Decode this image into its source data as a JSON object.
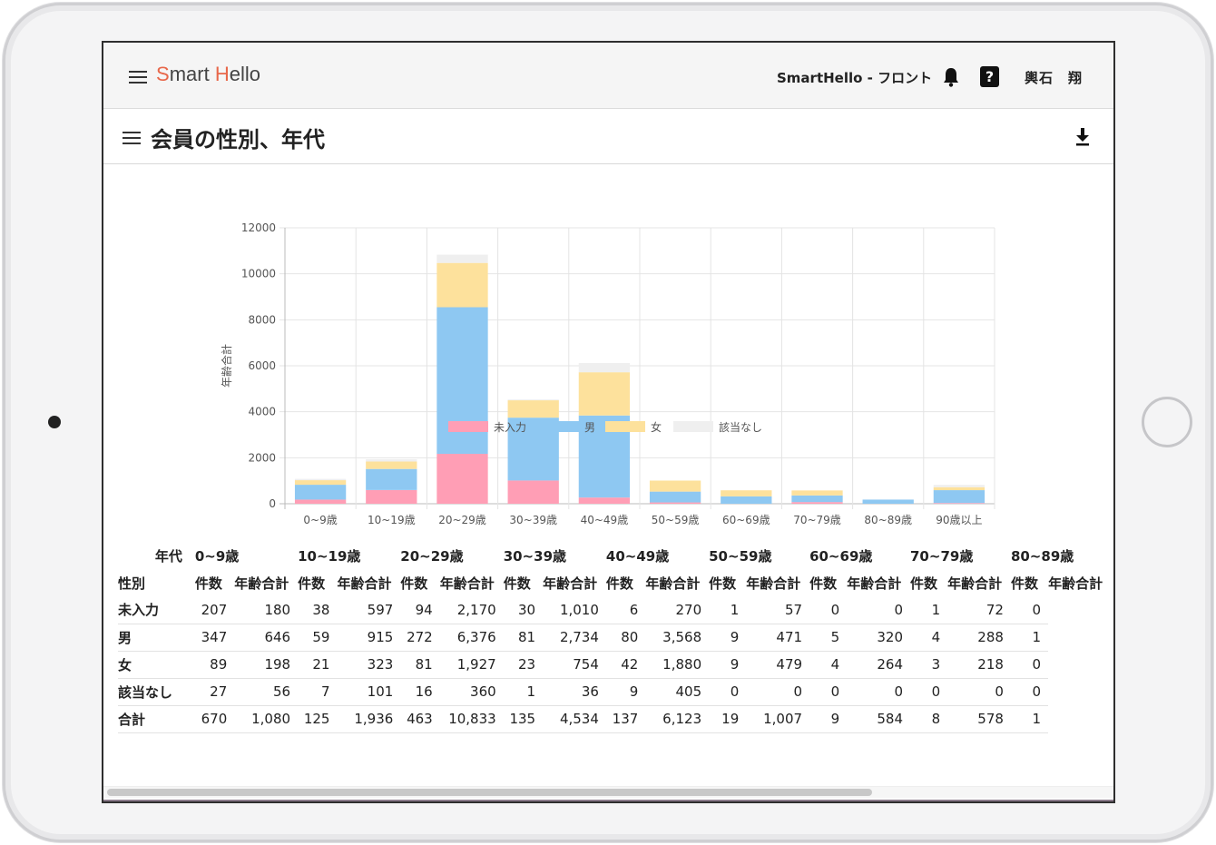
{
  "app": {
    "logo_a": "S",
    "logo_b": "mart ",
    "logo_c": "H",
    "logo_d": "ello",
    "store_name": "SmartHello - フロント",
    "user_name": "輿石　翔",
    "help_glyph": "?"
  },
  "page": {
    "title": "会員の性別、年代"
  },
  "colors": {
    "未入力": "#ff9eb5",
    "男": "#8ec8f2",
    "女": "#fde19c",
    "該当なし": "#efefef"
  },
  "chart_data": {
    "type": "bar",
    "stacked": true,
    "ylabel": "年齢合計",
    "ylim": [
      0,
      12000
    ],
    "yticks": [
      0,
      2000,
      4000,
      6000,
      8000,
      10000,
      12000
    ],
    "grid": true,
    "legend": "bottom",
    "categories": [
      "0~9歳",
      "10~19歳",
      "20~29歳",
      "30~39歳",
      "40~49歳",
      "50~59歳",
      "60~69歳",
      "70~79歳",
      "80~89歳",
      "90歳以上"
    ],
    "series": [
      {
        "name": "未入力",
        "values": [
          180,
          597,
          2170,
          1010,
          270,
          57,
          0,
          72,
          0,
          30
        ]
      },
      {
        "name": "男",
        "values": [
          646,
          915,
          6376,
          2734,
          3568,
          471,
          320,
          288,
          180,
          560
        ]
      },
      {
        "name": "女",
        "values": [
          198,
          323,
          1927,
          754,
          1880,
          479,
          264,
          218,
          0,
          130
        ]
      },
      {
        "name": "該当なし",
        "values": [
          56,
          101,
          360,
          36,
          405,
          0,
          0,
          0,
          0,
          100
        ]
      }
    ]
  },
  "table": {
    "corner_age": "年代",
    "corner_gender": "性別",
    "count_header": "件数",
    "sum_header": "年齢合計",
    "age_groups": [
      "0~9歳",
      "10~19歳",
      "20~29歳",
      "30~39歳",
      "40~49歳",
      "50~59歳",
      "60~69歳",
      "70~79歳",
      "80~89歳"
    ],
    "rows": [
      {
        "label": "未入力",
        "cells": [
          "207",
          "180",
          "38",
          "597",
          "94",
          "2,170",
          "30",
          "1,010",
          "6",
          "270",
          "1",
          "57",
          "0",
          "0",
          "1",
          "72",
          "0"
        ]
      },
      {
        "label": "男",
        "cells": [
          "347",
          "646",
          "59",
          "915",
          "272",
          "6,376",
          "81",
          "2,734",
          "80",
          "3,568",
          "9",
          "471",
          "5",
          "320",
          "4",
          "288",
          "1"
        ]
      },
      {
        "label": "女",
        "cells": [
          "89",
          "198",
          "21",
          "323",
          "81",
          "1,927",
          "23",
          "754",
          "42",
          "1,880",
          "9",
          "479",
          "4",
          "264",
          "3",
          "218",
          "0"
        ]
      },
      {
        "label": "該当なし",
        "cells": [
          "27",
          "56",
          "7",
          "101",
          "16",
          "360",
          "1",
          "36",
          "9",
          "405",
          "0",
          "0",
          "0",
          "0",
          "0",
          "0",
          "0"
        ]
      },
      {
        "label": "合計",
        "cells": [
          "670",
          "1,080",
          "125",
          "1,936",
          "463",
          "10,833",
          "135",
          "4,534",
          "137",
          "6,123",
          "19",
          "1,007",
          "9",
          "584",
          "8",
          "578",
          "1"
        ]
      }
    ]
  }
}
